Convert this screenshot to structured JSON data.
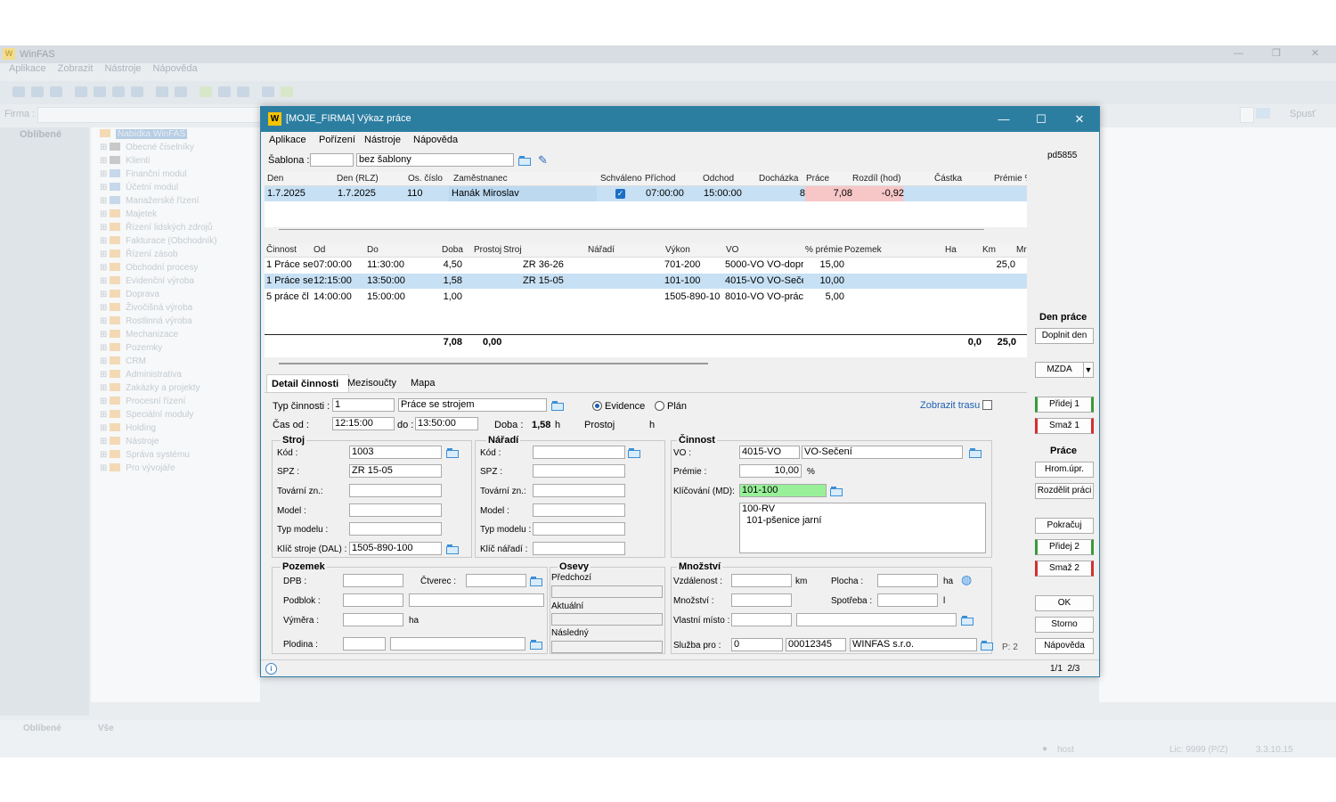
{
  "bg": {
    "app_title": "WinFAS",
    "menu": [
      "Aplikace",
      "Zobrazit",
      "Nástroje",
      "Nápověda"
    ],
    "firma_label": "Firma :",
    "spust": "Spusť",
    "left_header": "Oblíbené",
    "tree_root": "Nabídka WinFAS",
    "tree": [
      "Obecné číselníky",
      "Klienti",
      "Finanční modul",
      "Účetní modul",
      "Manažerské řízení",
      "Majetek",
      "Řízení lidských zdrojů",
      "Fakturace (Obchodník)",
      "Řízení zásob",
      "Obchodní procesy",
      "Evidenční výroba",
      "Doprava",
      "Živočišná výroba",
      "Rostlinná výroba",
      "Mechanizace",
      "Pozemky",
      "CRM",
      "Administrativa",
      "Zakázky a projekty",
      "Procesní řízení",
      "Speciální moduly",
      "Holding",
      "Nástroje",
      "Správa systému",
      "Pro vývojáře"
    ],
    "bottom_tabs": [
      "Oblíbené",
      "Vše"
    ],
    "status_user": "host",
    "status_lic": "Lic: 9999 (P/Z)",
    "status_ver": "3.3.10.15"
  },
  "dialog": {
    "title": "[MOJE_FIRMA] Výkaz práce",
    "menu": [
      "Aplikace",
      "Pořízení",
      "Nástroje",
      "Nápověda"
    ],
    "user_code": "pd5855",
    "sablona_label": "Šablona :",
    "sablona_code": "",
    "sablona_name": "bez šablony",
    "day_grid": {
      "headers": [
        "Den",
        "Den (RLZ)",
        "Os. číslo",
        "Zaměstnanec",
        "Schváleno",
        "Příchod",
        "Odchod",
        "Docházka",
        "Práce",
        "Rozdíl (hod)",
        "Částka",
        "Prémie %"
      ],
      "row": [
        "1.7.2025",
        "1.7.2025",
        "110",
        "Hanák Miroslav",
        "",
        "07:00:00",
        "15:00:00",
        "8",
        "7,08",
        "-0,92",
        "",
        ""
      ]
    },
    "act_grid": {
      "headers": [
        "Činnost",
        "Od",
        "Do",
        "Doba",
        "Prostoj",
        "Stroj",
        "Nářadí",
        "Výkon",
        "VO",
        "% prémie",
        "Pozemek",
        "Ha",
        "Km",
        "Mr"
      ],
      "rows": [
        [
          "1 Práce se",
          "07:00:00",
          "11:30:00",
          "4,50",
          "",
          "ZR 36-26",
          "",
          "701-200",
          "5000-VO VO-dopr",
          "15,00",
          "",
          "",
          "25,0",
          ""
        ],
        [
          "1 Práce se",
          "12:15:00",
          "13:50:00",
          "1,58",
          "",
          "ZR 15-05",
          "",
          "101-100",
          "4015-VO VO-Seče",
          "10,00",
          "",
          "",
          "",
          ""
        ],
        [
          "5 práce čl",
          "14:00:00",
          "15:00:00",
          "1,00",
          "",
          "",
          "",
          "1505-890-10",
          "8010-VO VO-prác",
          "5,00",
          "",
          "",
          "",
          ""
        ]
      ],
      "totals": {
        "doba": "7,08",
        "prostoj": "0,00",
        "ha": "0,0",
        "km": "25,0"
      }
    },
    "tabs": [
      "Detail činnosti",
      "Mezisoučty",
      "Mapa"
    ],
    "detail": {
      "typ_label": "Typ činnosti :",
      "typ_code": "1",
      "typ_name": "Práce se strojem",
      "evidence": "Evidence",
      "plan": "Plán",
      "zobrazit_trasu": "Zobrazit trasu",
      "cas_od_label": "Čas od :",
      "cas_od": "12:15:00",
      "do_label": "do :",
      "cas_do": "13:50:00",
      "doba_label": "Doba :",
      "doba": "1,58",
      "doba_unit": "h",
      "prostoj_label": "Prostoj",
      "prostoj_unit": "h"
    },
    "stroj": {
      "title": "Stroj",
      "kod_label": "Kód :",
      "kod": "1003",
      "spz_label": "SPZ :",
      "spz": "ZR 15-05",
      "tovarni_label": "Tovární zn.:",
      "model_label": "Model :",
      "typ_label": "Typ modelu :",
      "klic_label": "Klíč stroje (DAL) :",
      "klic": "1505-890-100"
    },
    "naradi": {
      "title": "Nářadí",
      "kod_label": "Kód :",
      "spz_label": "SPZ :",
      "tovarni_label": "Tovární zn.:",
      "model_label": "Model :",
      "typ_label": "Typ modelu :",
      "klic_label": "Klíč nářadí :"
    },
    "cinnost": {
      "title": "Činnost",
      "vo_label": "VO :",
      "vo_code": "4015-VO",
      "vo_name": "VO-Sečení",
      "premie_label": "Prémie :",
      "premie": "10,00",
      "premie_unit": "%",
      "klic_label": "Klíčování (MD):",
      "klic": "101-100",
      "memo1": "100-RV",
      "memo2": "101-pšenice jarní"
    },
    "pozemek": {
      "title": "Pozemek",
      "dpb_label": "DPB :",
      "ctverec_label": "Čtverec :",
      "podblok_label": "Podblok :",
      "vymera_label": "Výměra :",
      "vymera_unit": "ha",
      "plodina_label": "Plodina :"
    },
    "osevy": {
      "title": "Osevy",
      "predchozi": "Předchozí",
      "aktualni": "Aktuální",
      "nasledny": "Následný"
    },
    "mnozstvi": {
      "title": "Množství",
      "vzdalenost_label": "Vzdálenost :",
      "km_unit": "km",
      "plocha_label": "Plocha :",
      "ha_unit": "ha",
      "mnozstvi_label": "Množství :",
      "spotreba_label": "Spotřeba :",
      "l_unit": "l",
      "vlastni_label": "Vlastní místo :",
      "sluzba_label": "Služba pro :",
      "sluzba_code": "0",
      "sluzba_ico": "00012345",
      "sluzba_name": "WINFAS s.r.o.",
      "p_label": "P: 2"
    },
    "right": {
      "den_prace": "Den práce",
      "doplnit_den": "Doplnit den",
      "mzda": "MZDA",
      "pridej1": "Přidej 1",
      "smaz1": "Smaž 1",
      "prace": "Práce",
      "hrom": "Hrom.úpr.",
      "rozdelit": "Rozdělit práci",
      "pokracuj": "Pokračuj",
      "pridej2": "Přidej 2",
      "smaz2": "Smaž 2",
      "ok": "OK",
      "storno": "Storno",
      "napoveda": "Nápověda"
    },
    "status_pages": "1/1  2/3"
  }
}
